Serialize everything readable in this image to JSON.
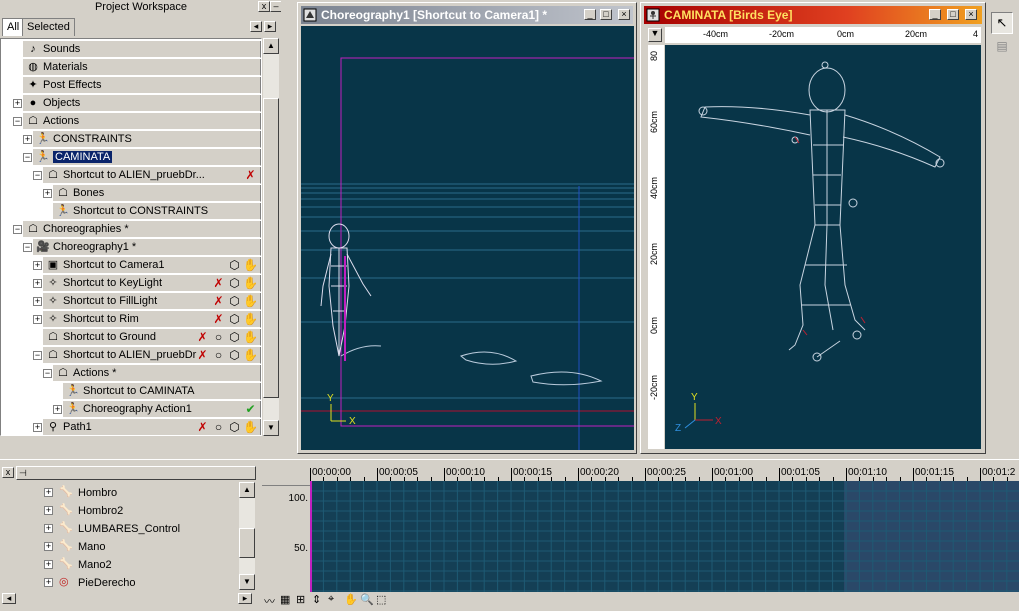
{
  "workspace": {
    "title": "Project Workspace",
    "tabs": [
      "All",
      "Selected"
    ],
    "tree": [
      {
        "label": "Sounds",
        "indent": 0,
        "icon": "sound-icon",
        "expander": "none"
      },
      {
        "label": "Materials",
        "indent": 0,
        "icon": "material-icon",
        "expander": "none"
      },
      {
        "label": "Post Effects",
        "indent": 0,
        "icon": "post-effects-icon",
        "expander": "none"
      },
      {
        "label": "Objects",
        "indent": 0,
        "icon": "objects-icon",
        "expander": "plus"
      },
      {
        "label": "Actions",
        "indent": 0,
        "icon": "actions-folder-icon",
        "expander": "minus"
      },
      {
        "label": "CONSTRAINTS",
        "indent": 1,
        "icon": "action-figure-icon",
        "expander": "plus"
      },
      {
        "label": "CAMINATA",
        "indent": 1,
        "icon": "action-figure-icon",
        "expander": "minus",
        "selected": true
      },
      {
        "label": "Shortcut to ALIEN_pruebDr...",
        "indent": 2,
        "icon": "model-shortcut-icon",
        "expander": "minus",
        "status": [
          "mute-icon"
        ]
      },
      {
        "label": "Bones",
        "indent": 3,
        "icon": "bones-folder-icon",
        "expander": "plus"
      },
      {
        "label": "Shortcut to CONSTRAINTS",
        "indent": 3,
        "icon": "action-figure-icon",
        "expander": "none"
      },
      {
        "label": "Choreographies *",
        "indent": 0,
        "icon": "choreographies-folder-icon",
        "expander": "minus"
      },
      {
        "label": "Choreography1 *",
        "indent": 1,
        "icon": "choreography-icon",
        "expander": "minus"
      },
      {
        "label": "Shortcut to Camera1",
        "indent": 2,
        "icon": "camera-icon",
        "expander": "plus",
        "status": [
          "cube-icon",
          "hand-icon"
        ]
      },
      {
        "label": "Shortcut to KeyLight",
        "indent": 2,
        "icon": "light-icon",
        "expander": "plus",
        "status": [
          "mute-icon",
          "cube-icon",
          "hand-icon"
        ]
      },
      {
        "label": "Shortcut to FillLight",
        "indent": 2,
        "icon": "light-icon",
        "expander": "plus",
        "status": [
          "mute-icon",
          "cube-icon",
          "hand-icon"
        ]
      },
      {
        "label": "Shortcut to Rim",
        "indent": 2,
        "icon": "light-icon",
        "expander": "plus",
        "status": [
          "mute-icon",
          "cube-icon",
          "hand-icon"
        ]
      },
      {
        "label": "Shortcut to Ground",
        "indent": 2,
        "icon": "ground-icon",
        "expander": "none",
        "status": [
          "mute-icon",
          "circle-icon",
          "cube-icon",
          "hand-off-icon"
        ]
      },
      {
        "label": "Shortcut to ALIEN_pruebDr",
        "indent": 2,
        "icon": "model-shortcut-icon",
        "expander": "minus",
        "status": [
          "mute-icon",
          "circle-icon",
          "cube-icon",
          "hand-icon"
        ]
      },
      {
        "label": "Actions *",
        "indent": 3,
        "icon": "actions-folder-icon",
        "expander": "minus"
      },
      {
        "label": "Shortcut to CAMINATA",
        "indent": 4,
        "icon": "action-figure-icon",
        "expander": "none"
      },
      {
        "label": "Choreography Action1",
        "indent": 4,
        "icon": "action-figure-icon",
        "expander": "plus",
        "status": [
          "check-icon"
        ]
      },
      {
        "label": "Path1",
        "indent": 2,
        "icon": "path-icon",
        "expander": "plus",
        "status": [
          "mute-icon",
          "circle-icon",
          "cube-icon",
          "hand-icon"
        ]
      }
    ]
  },
  "viewport_left": {
    "title": "Choreography1 [Shortcut to Camera1] *",
    "axes": {
      "y": "Y",
      "x": "X"
    }
  },
  "viewport_right": {
    "title": "CAMINATA [Birds Eye]",
    "ruler_top": [
      "-40cm",
      "-20cm",
      "0cm",
      "20cm",
      "4"
    ],
    "ruler_left": [
      "80",
      "60cm",
      "40cm",
      "20cm",
      "0cm",
      "-20cm"
    ],
    "axes": {
      "y": "Y",
      "x": "X",
      "z": "Z"
    }
  },
  "channels": [
    {
      "label": "Hombro",
      "icon": "bone-icon"
    },
    {
      "label": "Hombro2",
      "icon": "bone-icon"
    },
    {
      "label": "LUMBARES_Control",
      "icon": "bone-icon"
    },
    {
      "label": "Mano",
      "icon": "bone-icon"
    },
    {
      "label": "Mano2",
      "icon": "bone-icon"
    },
    {
      "label": "PieDerecho",
      "icon": "target-icon"
    }
  ],
  "timeline": {
    "ticks": [
      "00:00:00",
      "00:00:05",
      "00:00:10",
      "00:00:15",
      "00:00:20",
      "00:00:25",
      "00:01:00",
      "00:01:05",
      "00:01:10",
      "00:01:15",
      "00:01:2"
    ],
    "y_labels": [
      "100.",
      "50."
    ]
  },
  "colors": {
    "viewport_bg": "#083548",
    "title_active": "#0a246a",
    "title_active_end": "#a60000",
    "selection": "#0a246a"
  }
}
